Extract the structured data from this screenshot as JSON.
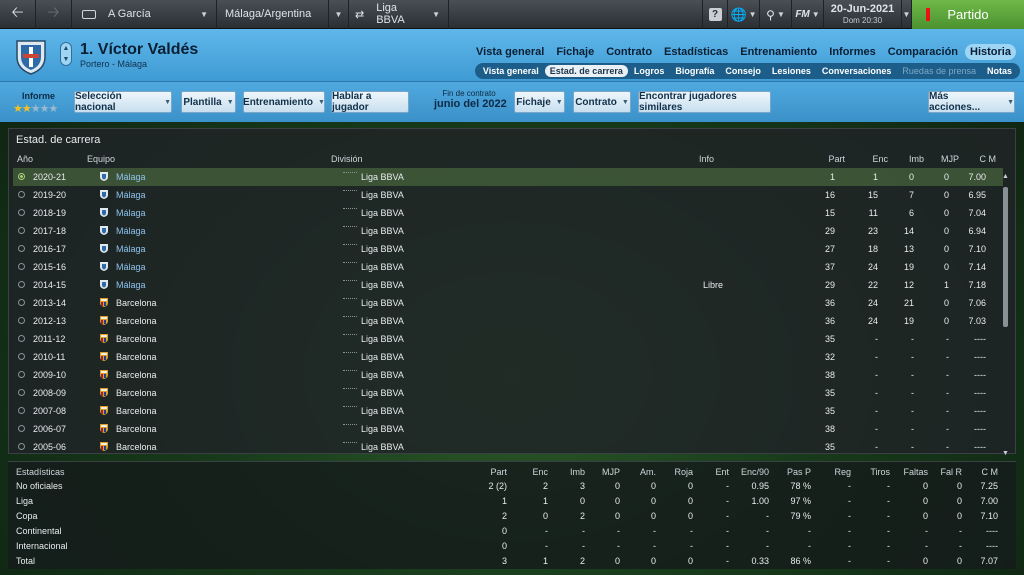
{
  "topbar": {
    "player_short": "A García",
    "club_nation": "Málaga/Argentina",
    "competition": "Liga BBVA",
    "fm_label": "FM",
    "date": "20-Jun-2021",
    "day_time": "Dom 20:30",
    "partido": "Partido"
  },
  "header": {
    "player_name": "1. Víctor Valdés",
    "player_role": "Portero - Málaga",
    "nav": [
      "Vista general",
      "Fichaje",
      "Contrato",
      "Estadísticas",
      "Entrenamiento",
      "Informes",
      "Comparación",
      "Historia"
    ],
    "subnav": [
      "Vista general",
      "Estad. de carrera",
      "Logros",
      "Biografía",
      "Consejo",
      "Lesiones",
      "Conversaciones",
      "Ruedas de prensa",
      "Notas"
    ]
  },
  "toolbar": {
    "informe_label": "Informe",
    "stars_filled": 2,
    "stars_total": 5,
    "seleccion": "Selección nacional",
    "plantilla": "Plantilla",
    "entrenamiento": "Entrenamiento",
    "hablar": "Hablar a jugador",
    "contract_label": "Fin de contrato",
    "contract_date": "junio del 2022",
    "fichaje": "Fichaje",
    "contrato": "Contrato",
    "similares": "Encontrar jugadores similares",
    "mas": "Más acciones..."
  },
  "career": {
    "title": "Estad. de carrera",
    "columns": {
      "year": "Año",
      "team": "Equipo",
      "division": "División",
      "info": "Info",
      "apps": "Part",
      "gc": "Enc",
      "cs": "Imb",
      "pom": "MJP",
      "avg": "C M"
    },
    "rows": [
      {
        "year": "2020-21",
        "team": "Málaga",
        "division": "Liga BBVA",
        "info": "",
        "apps": "1",
        "gc": "1",
        "cs": "0",
        "pom": "0",
        "avg": "7.00"
      },
      {
        "year": "2019-20",
        "team": "Málaga",
        "division": "Liga BBVA",
        "info": "",
        "apps": "16",
        "gc": "15",
        "cs": "7",
        "pom": "0",
        "avg": "6.95"
      },
      {
        "year": "2018-19",
        "team": "Málaga",
        "division": "Liga BBVA",
        "info": "",
        "apps": "15",
        "gc": "11",
        "cs": "6",
        "pom": "0",
        "avg": "7.04"
      },
      {
        "year": "2017-18",
        "team": "Málaga",
        "division": "Liga BBVA",
        "info": "",
        "apps": "29",
        "gc": "23",
        "cs": "14",
        "pom": "0",
        "avg": "6.94"
      },
      {
        "year": "2016-17",
        "team": "Málaga",
        "division": "Liga BBVA",
        "info": "",
        "apps": "27",
        "gc": "18",
        "cs": "13",
        "pom": "0",
        "avg": "7.10"
      },
      {
        "year": "2015-16",
        "team": "Málaga",
        "division": "Liga BBVA",
        "info": "",
        "apps": "37",
        "gc": "24",
        "cs": "19",
        "pom": "0",
        "avg": "7.14"
      },
      {
        "year": "2014-15",
        "team": "Málaga",
        "division": "Liga BBVA",
        "info": "Libre",
        "apps": "29",
        "gc": "22",
        "cs": "12",
        "pom": "1",
        "avg": "7.18"
      },
      {
        "year": "2013-14",
        "team": "Barcelona",
        "division": "Liga BBVA",
        "info": "",
        "apps": "36",
        "gc": "24",
        "cs": "21",
        "pom": "0",
        "avg": "7.06"
      },
      {
        "year": "2012-13",
        "team": "Barcelona",
        "division": "Liga BBVA",
        "info": "",
        "apps": "36",
        "gc": "24",
        "cs": "19",
        "pom": "0",
        "avg": "7.03"
      },
      {
        "year": "2011-12",
        "team": "Barcelona",
        "division": "Liga BBVA",
        "info": "",
        "apps": "35",
        "gc": "-",
        "cs": "-",
        "pom": "-",
        "avg": "----"
      },
      {
        "year": "2010-11",
        "team": "Barcelona",
        "division": "Liga BBVA",
        "info": "",
        "apps": "32",
        "gc": "-",
        "cs": "-",
        "pom": "-",
        "avg": "----"
      },
      {
        "year": "2009-10",
        "team": "Barcelona",
        "division": "Liga BBVA",
        "info": "",
        "apps": "38",
        "gc": "-",
        "cs": "-",
        "pom": "-",
        "avg": "----"
      },
      {
        "year": "2008-09",
        "team": "Barcelona",
        "division": "Liga BBVA",
        "info": "",
        "apps": "35",
        "gc": "-",
        "cs": "-",
        "pom": "-",
        "avg": "----"
      },
      {
        "year": "2007-08",
        "team": "Barcelona",
        "division": "Liga BBVA",
        "info": "",
        "apps": "35",
        "gc": "-",
        "cs": "-",
        "pom": "-",
        "avg": "----"
      },
      {
        "year": "2006-07",
        "team": "Barcelona",
        "division": "Liga BBVA",
        "info": "",
        "apps": "38",
        "gc": "-",
        "cs": "-",
        "pom": "-",
        "avg": "----"
      },
      {
        "year": "2005-06",
        "team": "Barcelona",
        "division": "Liga BBVA",
        "info": "",
        "apps": "35",
        "gc": "-",
        "cs": "-",
        "pom": "-",
        "avg": "----"
      }
    ]
  },
  "season": {
    "title": "Estadísticas",
    "columns": [
      "Part",
      "Enc",
      "Imb",
      "MJP",
      "Am.",
      "Roja",
      "Ent",
      "Enc/90",
      "Pas P",
      "Reg",
      "Tiros",
      "Faltas",
      "Fal R",
      "C M"
    ],
    "rows": [
      {
        "label": "No oficiales",
        "vals": [
          "2 (2)",
          "2",
          "3",
          "0",
          "0",
          "0",
          "-",
          "0.95",
          "78 %",
          "-",
          "-",
          "0",
          "0",
          "7.25"
        ]
      },
      {
        "label": "Liga",
        "vals": [
          "1",
          "1",
          "0",
          "0",
          "0",
          "0",
          "-",
          "1.00",
          "97 %",
          "-",
          "-",
          "0",
          "0",
          "7.00"
        ]
      },
      {
        "label": "Copa",
        "vals": [
          "2",
          "0",
          "2",
          "0",
          "0",
          "0",
          "-",
          "-",
          "79 %",
          "-",
          "-",
          "0",
          "0",
          "7.10"
        ]
      },
      {
        "label": "Continental",
        "vals": [
          "0",
          "-",
          "-",
          "-",
          "-",
          "-",
          "-",
          "-",
          "-",
          "-",
          "-",
          "-",
          "-",
          "----"
        ]
      },
      {
        "label": "Internacional",
        "vals": [
          "0",
          "-",
          "-",
          "-",
          "-",
          "-",
          "-",
          "-",
          "-",
          "-",
          "-",
          "-",
          "-",
          "----"
        ]
      },
      {
        "label": "Total",
        "vals": [
          "3",
          "1",
          "2",
          "0",
          "0",
          "0",
          "-",
          "0.33",
          "86 %",
          "-",
          "-",
          "0",
          "0",
          "7.07"
        ]
      }
    ]
  }
}
